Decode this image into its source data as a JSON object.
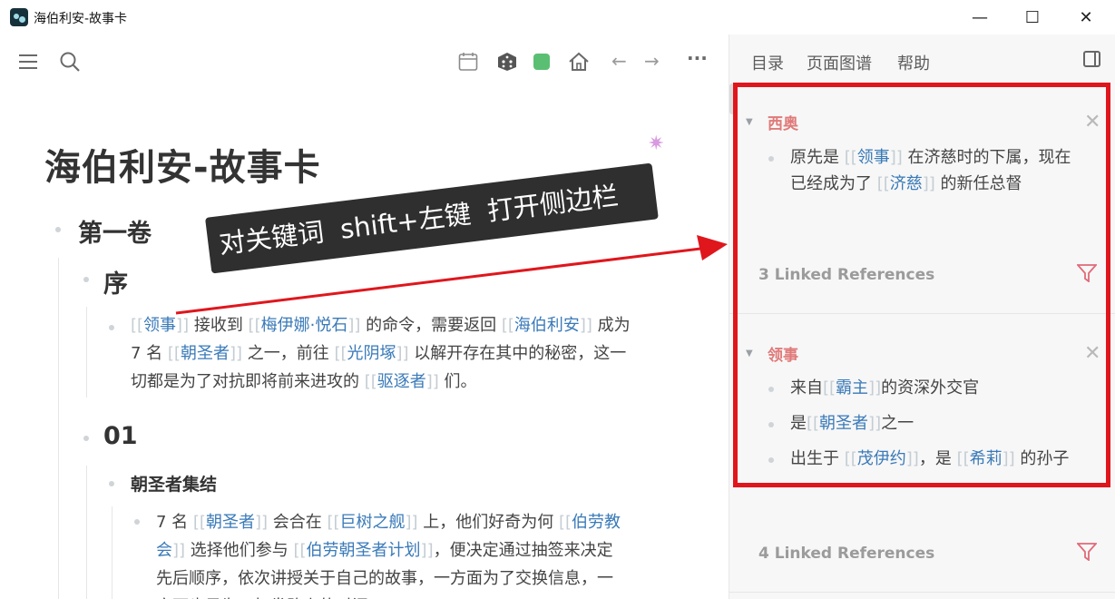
{
  "window": {
    "title": "海伯利安-故事卡",
    "minimize": "—",
    "maximize": "☐",
    "close": "✕"
  },
  "toolbar": {
    "menu_icon": "☰",
    "search_icon": "⌕",
    "calendar_icon": "▦",
    "dice_icon": "⚄",
    "home_icon": "⌂",
    "back_icon": "←",
    "forward_icon": "→",
    "more_icon": "···",
    "green_color": "#5bbf73"
  },
  "page": {
    "title": "海伯利安-故事卡",
    "sparkle": "✷",
    "volume": "第一卷",
    "section_prologue": "序",
    "prologue_para": [
      {
        "t": "[[",
        "k": "br"
      },
      {
        "t": "领事",
        "k": "ln"
      },
      {
        "t": "]]",
        "k": "br"
      },
      {
        "t": " 接收到 "
      },
      {
        "t": "[[",
        "k": "br"
      },
      {
        "t": "梅伊娜·悦石",
        "k": "ln"
      },
      {
        "t": "]]",
        "k": "br"
      },
      {
        "t": " 的命令，需要返回 "
      },
      {
        "t": "[[",
        "k": "br"
      },
      {
        "t": "海伯利安",
        "k": "ln"
      },
      {
        "t": "]]",
        "k": "br"
      },
      {
        "t": " 成为\n7 名 "
      },
      {
        "t": "[[",
        "k": "br"
      },
      {
        "t": "朝圣者",
        "k": "ln"
      },
      {
        "t": "]]",
        "k": "br"
      },
      {
        "t": " 之一，前往 "
      },
      {
        "t": "[[",
        "k": "br"
      },
      {
        "t": "光阴塚",
        "k": "ln"
      },
      {
        "t": "]]",
        "k": "br"
      },
      {
        "t": " 以解开存在其中的秘密，这一\n切都是为了对抗即将前来进攻的 "
      },
      {
        "t": "[[",
        "k": "br"
      },
      {
        "t": "驱逐者",
        "k": "ln"
      },
      {
        "t": "]]",
        "k": "br"
      },
      {
        "t": " 们。"
      }
    ],
    "section_01": "01",
    "subsection": "朝圣者集结",
    "gather_para": [
      {
        "t": "7 名 "
      },
      {
        "t": "[[",
        "k": "br"
      },
      {
        "t": "朝圣者",
        "k": "ln"
      },
      {
        "t": "]]",
        "k": "br"
      },
      {
        "t": " 会合在 "
      },
      {
        "t": "[[",
        "k": "br"
      },
      {
        "t": "巨树之舰",
        "k": "ln"
      },
      {
        "t": "]]",
        "k": "br"
      },
      {
        "t": " 上，他们好奇为何 "
      },
      {
        "t": "[[",
        "k": "br"
      },
      {
        "t": "伯劳教\n会",
        "k": "ln"
      },
      {
        "t": "]]",
        "k": "br"
      },
      {
        "t": " 选择他们参与 "
      },
      {
        "t": "[[",
        "k": "br"
      },
      {
        "t": "伯劳朝圣者计划",
        "k": "ln"
      },
      {
        "t": "]]",
        "k": "br"
      },
      {
        "t": "，便决定通过抽签来决定\n先后顺序，依次讲授关于自己的故事，一方面为了交换信息，一\n方面也是为了打发路上的时间。"
      }
    ]
  },
  "annotation": {
    "text": "对关键词  shift+左键  打开侧边栏",
    "arrow_color": "#e0161d"
  },
  "sidebar": {
    "tabs": [
      "目录",
      "页面图谱",
      "帮助"
    ],
    "cards": [
      {
        "title": "西奥",
        "blocks": [
          [
            {
              "t": "原先是 "
            },
            {
              "t": "[[",
              "k": "br"
            },
            {
              "t": "领事",
              "k": "ln"
            },
            {
              "t": "]]",
              "k": "br"
            },
            {
              "t": " 在济慈时的下属，现在\n已经成为了 "
            },
            {
              "t": "[[",
              "k": "br"
            },
            {
              "t": "济慈",
              "k": "ln"
            },
            {
              "t": "]]",
              "k": "br"
            },
            {
              "t": " 的新任总督"
            }
          ]
        ],
        "linked": "3 Linked References"
      },
      {
        "title": "领事",
        "blocks": [
          [
            {
              "t": "来自"
            },
            {
              "t": "[[",
              "k": "br"
            },
            {
              "t": "霸主",
              "k": "ln"
            },
            {
              "t": "]]",
              "k": "br"
            },
            {
              "t": "的资深外交官"
            }
          ],
          [
            {
              "t": "是"
            },
            {
              "t": "[[",
              "k": "br"
            },
            {
              "t": "朝圣者",
              "k": "ln"
            },
            {
              "t": "]]",
              "k": "br"
            },
            {
              "t": "之一"
            }
          ],
          [
            {
              "t": "出生于 "
            },
            {
              "t": "[[",
              "k": "br"
            },
            {
              "t": "茂伊约",
              "k": "ln"
            },
            {
              "t": "]]",
              "k": "br"
            },
            {
              "t": "，是 "
            },
            {
              "t": "[[",
              "k": "br"
            },
            {
              "t": "希莉",
              "k": "ln"
            },
            {
              "t": "]]",
              "k": "br"
            },
            {
              "t": " 的孙子"
            }
          ]
        ],
        "linked": "4 Linked References"
      }
    ],
    "close_icon": "✕",
    "caret_icon": "▼",
    "highlight_color": "#e0161d"
  }
}
